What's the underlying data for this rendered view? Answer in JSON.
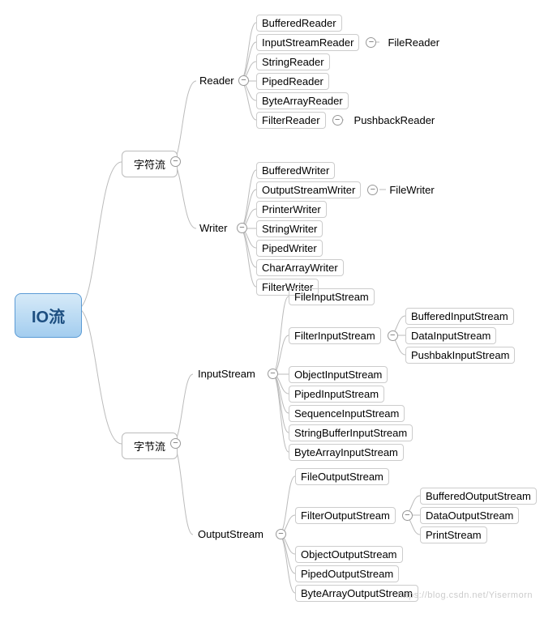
{
  "root": "IO流",
  "l1": {
    "char": "字符流",
    "byte": "字节流"
  },
  "l2": {
    "reader": "Reader",
    "writer": "Writer",
    "in": "InputStream",
    "out": "OutputStream"
  },
  "reader": {
    "bufferedReader": "BufferedReader",
    "inputStreamReader": "InputStreamReader",
    "fileReader": "FileReader",
    "stringReader": "StringReader",
    "pipedReader": "PipedReader",
    "byteArrayReader": "ByteArrayReader",
    "filterReader": "FilterReader",
    "pushbackReader": "PushbackReader"
  },
  "writer": {
    "bufferedWriter": "BufferedWriter",
    "outputStreamWriter": "OutputStreamWriter",
    "fileWriter": "FileWriter",
    "printerWriter": "PrinterWriter",
    "stringWriter": "StringWriter",
    "pipedWriter": "PipedWriter",
    "charArrayWriter": "CharArrayWriter",
    "filterWriter": "FilterWriter"
  },
  "in": {
    "fileInputStream": "FileInputStream",
    "filterInputStream": "FilterInputStream",
    "bufferedInputStream": "BufferedInputStream",
    "dataInputStream": "DataInputStream",
    "pushbakInputStream": "PushbakInputStream",
    "objectInputStream": "ObjectInputStream",
    "pipedInputStream": "PipedInputStream",
    "sequenceInputStream": "SequenceInputStream",
    "stringBufferInputStream": "StringBufferInputStream",
    "byteArrayInputStream": "ByteArrayInputStream"
  },
  "out": {
    "fileOutputStream": "FileOutputStream",
    "filterOutputStream": "FilterOutputStream",
    "bufferedOutputStream": "BufferedOutputStream",
    "dataOutputStream": "DataOutputStream",
    "printStream": "PrintStream",
    "objectOutputStream": "ObjectOutputStream",
    "pipedOutputStream": "PipedOutputStream",
    "byteArrayOutputStream": "ByteArrayOutputStream"
  },
  "watermark": "https://blog.csdn.net/Yisermorn"
}
